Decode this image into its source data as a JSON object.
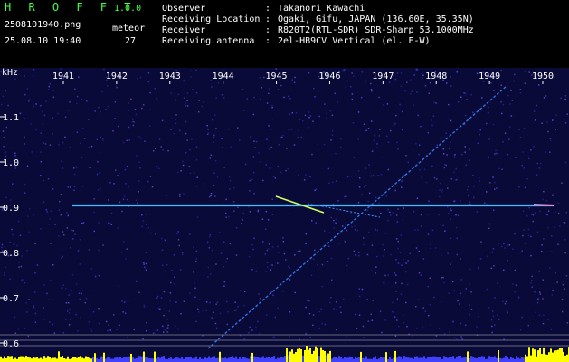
{
  "header": {
    "app_title": "H R O F F T",
    "app_version": "1.0.0",
    "file_name": "2508101940.png",
    "meteor_label": "meteor",
    "datetime": "25.08.10 19:40",
    "meteor_count": "27",
    "info": [
      {
        "key": "Observer",
        "value": "Takanori Kawachi"
      },
      {
        "key": "Receiving Location",
        "value": "Ogaki, Gifu, JAPAN (136.60E, 35.35N)"
      },
      {
        "key": "Receiver",
        "value": "R820T2(RTL-SDR) SDR-Sharp 53.1000MHz"
      },
      {
        "key": "Receiving antenna",
        "value": "2el-HB9CV Vertical (el. E-W)"
      }
    ]
  },
  "spectrogram": {
    "y_unit": "kHz",
    "time_ticks": [
      "1941",
      "1942",
      "1943",
      "1944",
      "1945",
      "1946",
      "1947",
      "1948",
      "1949",
      "1950"
    ],
    "freq_ticks": [
      "1.1",
      "1.0",
      "0.9",
      "0.8",
      "0.7",
      "0.6"
    ],
    "colors": {
      "background": "#0a0a38",
      "text": "#ffffff",
      "signal": "#40c0ff",
      "power": "#ffff00"
    }
  }
}
